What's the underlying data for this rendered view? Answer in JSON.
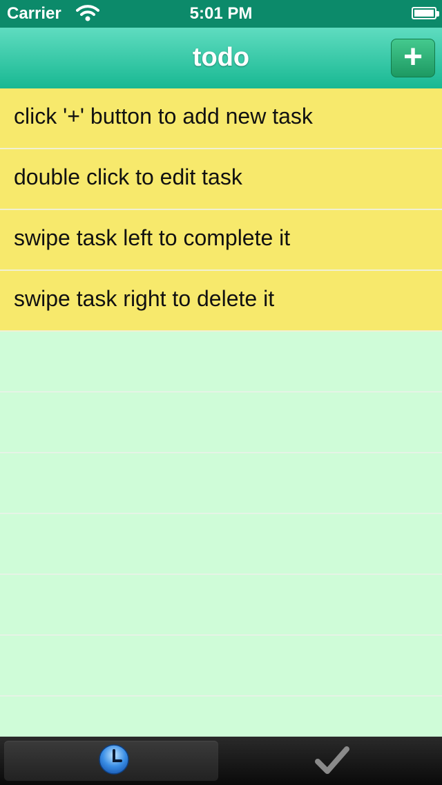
{
  "status_bar": {
    "carrier": "Carrier",
    "time": "5:01 PM"
  },
  "nav": {
    "title": "todo",
    "add_label": "+"
  },
  "tasks": [
    {
      "label": "click '+' button to add new task"
    },
    {
      "label": "double click to edit task"
    },
    {
      "label": "swipe task left to complete it"
    },
    {
      "label": "swipe task right to delete it"
    }
  ],
  "tabbar": {
    "tabs": [
      {
        "icon": "clock-icon",
        "active": true
      },
      {
        "icon": "checkmark-icon",
        "active": false
      }
    ]
  },
  "colors": {
    "nav_top": "#5fdcc0",
    "nav_bottom": "#18b892",
    "task_bg": "#f7e96c",
    "empty_bg": "#cffcd8",
    "add_button": "#2fb57a"
  }
}
